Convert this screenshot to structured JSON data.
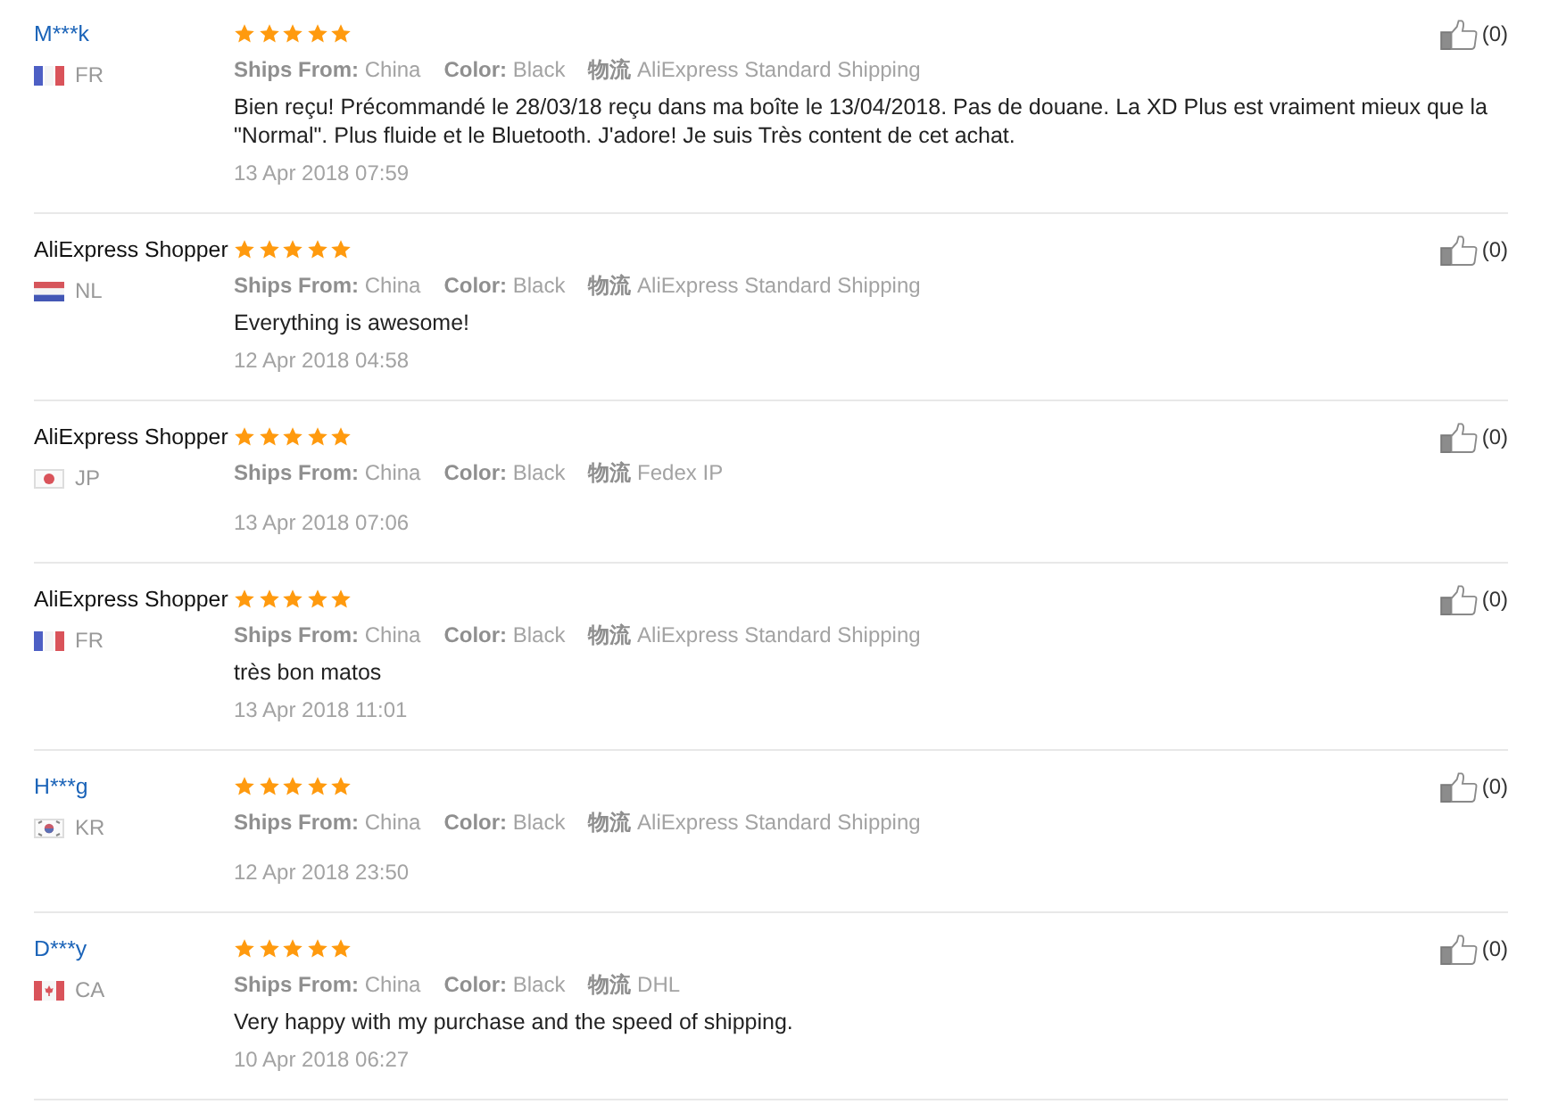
{
  "reviews": [
    {
      "reviewer": {
        "name": "M***k",
        "kind": "member",
        "country": {
          "code": "FR",
          "kind": "fr"
        }
      },
      "stars": 5,
      "details": [
        {
          "label": "Ships From:",
          "value": "China"
        },
        {
          "label": "Color:",
          "value": "Black"
        },
        {
          "label": "物流",
          "value": "AliExpress Standard Shipping"
        }
      ],
      "text": "Bien reçu! Précommandé le 28/03/18 reçu dans ma boîte le 13/04/2018. Pas de douane. La XD Plus est vraiment mieux que la \"Normal\". Plus fluide et le Bluetooth. J'adore! Je suis Très content de cet achat.",
      "date": "13 Apr 2018 07:59",
      "likes": "(0)"
    },
    {
      "reviewer": {
        "name": "AliExpress Shopper",
        "kind": "guest",
        "country": {
          "code": "NL",
          "kind": "nl"
        }
      },
      "stars": 5,
      "details": [
        {
          "label": "Ships From:",
          "value": "China"
        },
        {
          "label": "Color:",
          "value": "Black"
        },
        {
          "label": "物流",
          "value": "AliExpress Standard Shipping"
        }
      ],
      "text": "Everything is awesome!",
      "date": "12 Apr 2018 04:58",
      "likes": "(0)"
    },
    {
      "reviewer": {
        "name": "AliExpress Shopper",
        "kind": "guest",
        "country": {
          "code": "JP",
          "kind": "jp"
        }
      },
      "stars": 5,
      "details": [
        {
          "label": "Ships From:",
          "value": "China"
        },
        {
          "label": "Color:",
          "value": "Black"
        },
        {
          "label": "物流",
          "value": "Fedex IP"
        }
      ],
      "date": "13 Apr 2018 07:06",
      "likes": "(0)"
    },
    {
      "reviewer": {
        "name": "AliExpress Shopper",
        "kind": "guest",
        "country": {
          "code": "FR",
          "kind": "fr"
        }
      },
      "stars": 5,
      "details": [
        {
          "label": "Ships From:",
          "value": "China"
        },
        {
          "label": "Color:",
          "value": "Black"
        },
        {
          "label": "物流",
          "value": "AliExpress Standard Shipping"
        }
      ],
      "text": "très bon matos",
      "date": "13 Apr 2018 11:01",
      "likes": "(0)"
    },
    {
      "reviewer": {
        "name": "H***g",
        "kind": "member",
        "country": {
          "code": "KR",
          "kind": "kr"
        }
      },
      "stars": 5,
      "details": [
        {
          "label": "Ships From:",
          "value": "China"
        },
        {
          "label": "Color:",
          "value": "Black"
        },
        {
          "label": "物流",
          "value": "AliExpress Standard Shipping"
        }
      ],
      "date": "12 Apr 2018 23:50",
      "likes": "(0)"
    },
    {
      "reviewer": {
        "name": "D***y",
        "kind": "member",
        "country": {
          "code": "CA",
          "kind": "ca"
        }
      },
      "stars": 5,
      "details": [
        {
          "label": "Ships From:",
          "value": "China"
        },
        {
          "label": "Color:",
          "value": "Black"
        },
        {
          "label": "物流",
          "value": "DHL"
        }
      ],
      "text": "Very happy with my purchase and the speed of shipping.",
      "date": "10 Apr 2018 06:27",
      "likes": "(0)"
    }
  ]
}
